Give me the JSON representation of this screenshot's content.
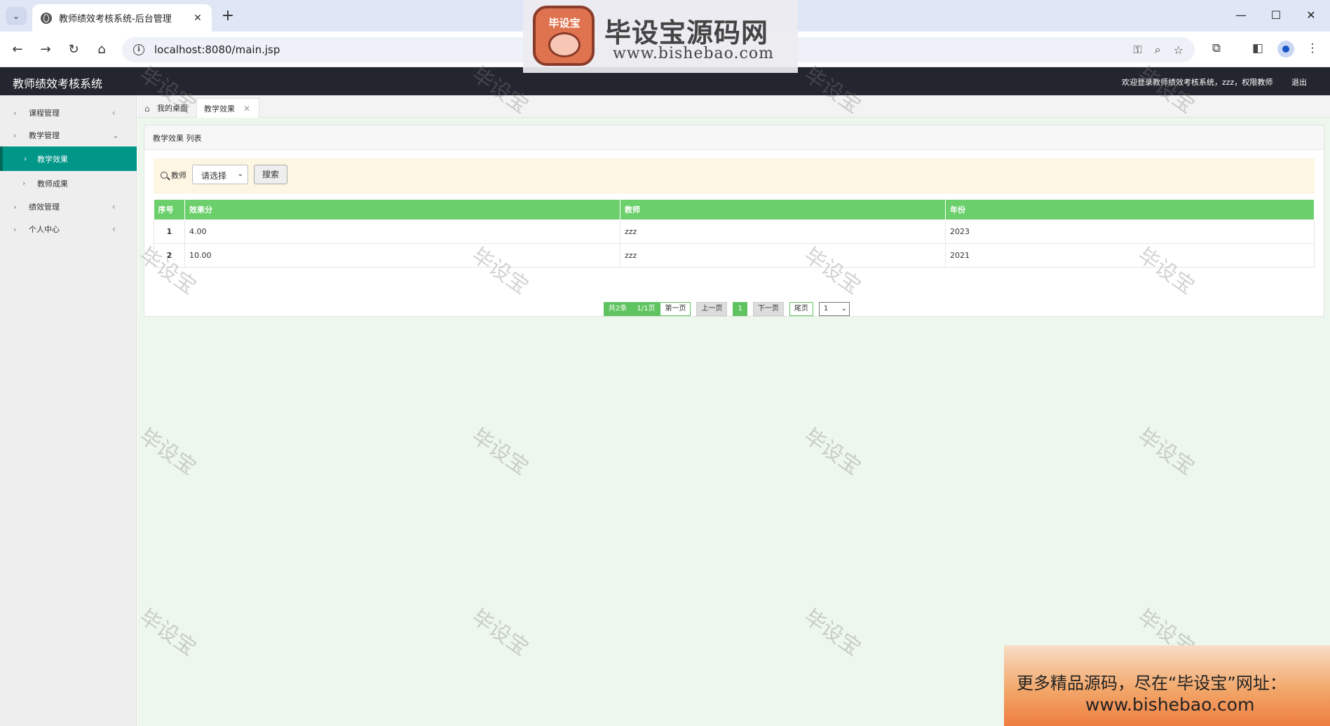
{
  "browser": {
    "tab_title": "教师绩效考核系统-后台管理",
    "tab_close": "✕",
    "new_tab": "+",
    "url": "localhost:8080/main.jsp"
  },
  "watermark_banner": {
    "logo_text": "毕设宝",
    "site_name": "毕设宝源码网",
    "site_url": "www.bishebao.com"
  },
  "app": {
    "title": "教师绩效考核系统",
    "welcome": "欢迎登录教师绩效考核系统，zzz，权限教师",
    "logout": "退出"
  },
  "sidebar": {
    "items": [
      {
        "label": "课程管理"
      },
      {
        "label": "教学管理"
      },
      {
        "label": "教学效果"
      },
      {
        "label": "教师成果"
      },
      {
        "label": "绩效管理"
      },
      {
        "label": "个人中心"
      }
    ]
  },
  "content_tabs": {
    "home": "我的桌面",
    "active": "教学效果"
  },
  "panel": {
    "title": "教学效果 列表"
  },
  "search": {
    "label": "教师",
    "select_value": "请选择",
    "button": "搜索"
  },
  "table": {
    "columns": [
      "序号",
      "效果分",
      "教师",
      "年份"
    ],
    "rows": [
      [
        "1",
        "4.00",
        "zzz",
        "2023"
      ],
      [
        "2",
        "10.00",
        "zzz",
        "2021"
      ]
    ]
  },
  "pager": {
    "total": "共2条",
    "pages": "1/1页",
    "first": "第一页",
    "prev": "上一页",
    "current": "1",
    "next": "下一页",
    "last": "尾页",
    "jump_value": "1"
  },
  "watermark_text": "毕设宝",
  "ad": {
    "line1": "更多精品源码，尽在“毕设宝”网址：",
    "line2": "www.bishebao.com"
  }
}
